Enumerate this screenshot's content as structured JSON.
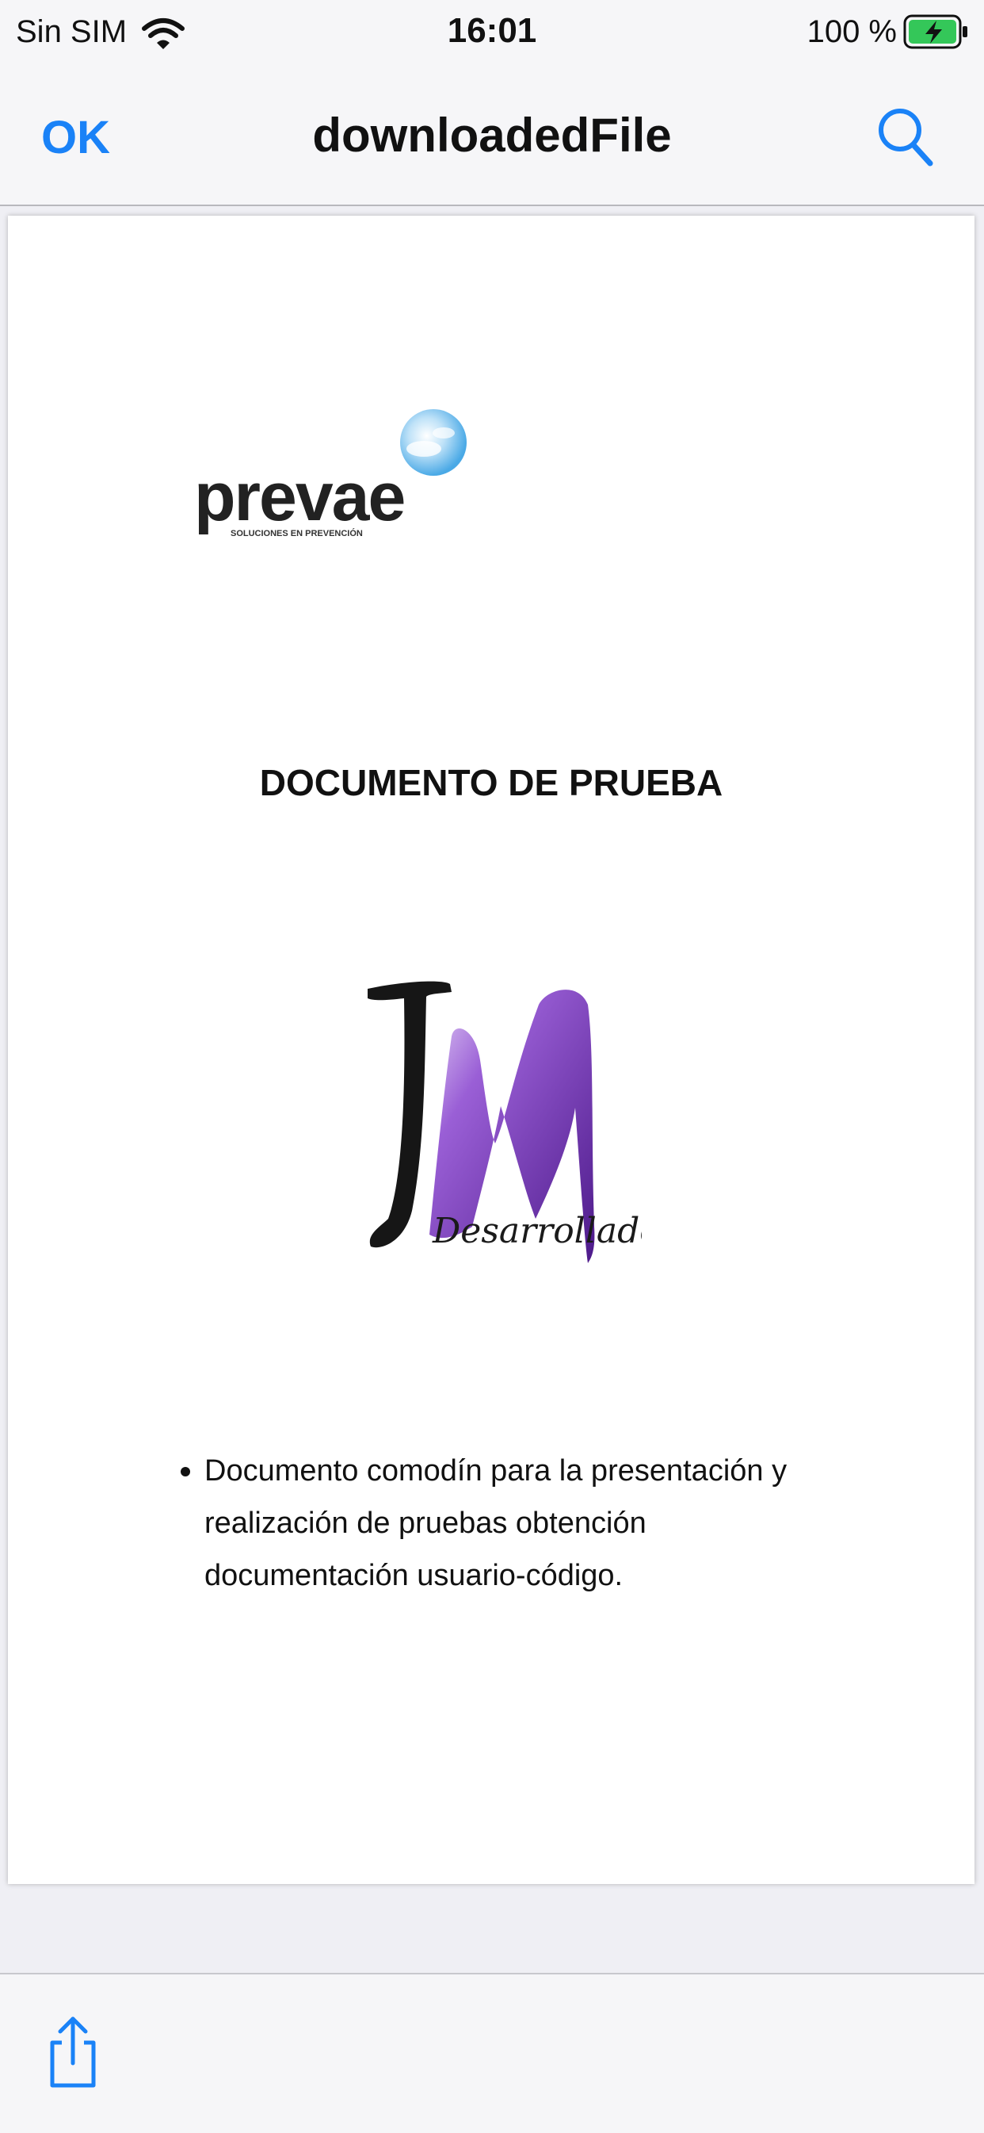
{
  "status_bar": {
    "carrier": "Sin SIM",
    "time": "16:01",
    "battery_percent": "100 %",
    "icons": [
      "wifi-icon",
      "battery-charging-icon"
    ]
  },
  "nav_bar": {
    "done_label": "OK",
    "title": "downloadedFile",
    "search_icon": "search-icon",
    "accent_color": "#1a82f7"
  },
  "document": {
    "logo_text": "prevae",
    "logo_tagline": "SOLUCIONES EN PREVENCIÓN",
    "heading": "DOCUMENTO DE PRUEBA",
    "developer_logo_letters": "JM",
    "developer_logo_caption": "Desarrollador.",
    "bullet_lines": [
      "Documento comodín para la presentación y",
      "realización de pruebas obtención",
      "documentación usuario-código."
    ]
  },
  "toolbar": {
    "share_icon": "share-icon"
  }
}
